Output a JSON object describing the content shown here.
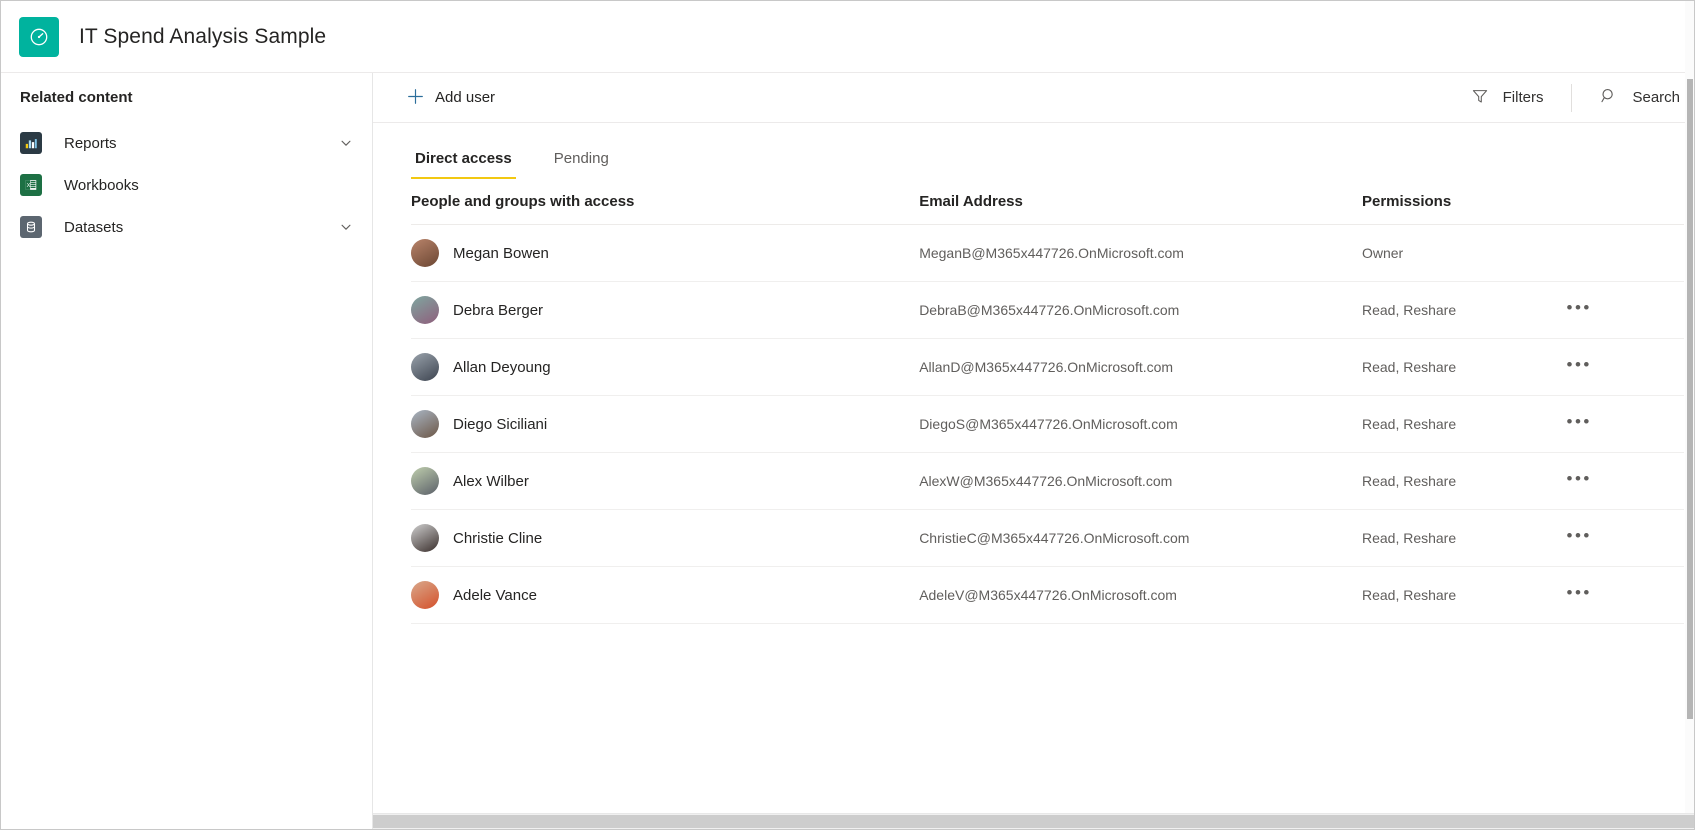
{
  "header": {
    "title": "IT Spend Analysis Sample",
    "logo_icon": "gauge-icon",
    "logo_color": "#00b39e"
  },
  "sidebar": {
    "title": "Related content",
    "items": [
      {
        "label": "Reports",
        "icon": "bar-chart-icon",
        "icon_color": "#2b3a44",
        "expandable": true
      },
      {
        "label": "Workbooks",
        "icon": "excel-sheet-icon",
        "icon_color": "#1d7044",
        "expandable": false
      },
      {
        "label": "Datasets",
        "icon": "database-icon",
        "icon_color": "#5c6670",
        "expandable": true
      }
    ]
  },
  "commandbar": {
    "add_user": {
      "label": "Add user",
      "icon": "plus-icon"
    },
    "filters": {
      "label": "Filters",
      "icon": "filter-icon"
    },
    "search": {
      "label": "Search",
      "icon": "search-icon"
    }
  },
  "tabs": [
    {
      "label": "Direct access",
      "active": true
    },
    {
      "label": "Pending",
      "active": false
    }
  ],
  "table": {
    "columns": [
      "People and groups with access",
      "Email Address",
      "Permissions"
    ],
    "menu_glyph": "•••",
    "rows": [
      {
        "name": "Megan Bowen",
        "email": "MeganB@M365x447726.OnMicrosoft.com",
        "permissions": "Owner",
        "has_menu": false,
        "avatar_a": "#b9846b",
        "avatar_b": "#6b4632"
      },
      {
        "name": "Debra Berger",
        "email": "DebraB@M365x447726.OnMicrosoft.com",
        "permissions": "Read, Reshare",
        "has_menu": true,
        "avatar_a": "#7fa7a0",
        "avatar_b": "#8f5e7c"
      },
      {
        "name": "Allan Deyoung",
        "email": "AllanD@M365x447726.OnMicrosoft.com",
        "permissions": "Read, Reshare",
        "has_menu": true,
        "avatar_a": "#9aa3ac",
        "avatar_b": "#3d4450"
      },
      {
        "name": "Diego Siciliani",
        "email": "DiegoS@M365x447726.OnMicrosoft.com",
        "permissions": "Read, Reshare",
        "has_menu": true,
        "avatar_a": "#a9b6c4",
        "avatar_b": "#6c5646"
      },
      {
        "name": "Alex Wilber",
        "email": "AlexW@M365x447726.OnMicrosoft.com",
        "permissions": "Read, Reshare",
        "has_menu": true,
        "avatar_a": "#c0cfae",
        "avatar_b": "#5a5f68"
      },
      {
        "name": "Christie Cline",
        "email": "ChristieC@M365x447726.OnMicrosoft.com",
        "permissions": "Read, Reshare",
        "has_menu": true,
        "avatar_a": "#cfcfcf",
        "avatar_b": "#3a2f2c"
      },
      {
        "name": "Adele Vance",
        "email": "AdeleV@M365x447726.OnMicrosoft.com",
        "permissions": "Read, Reshare",
        "has_menu": true,
        "avatar_a": "#d9a98c",
        "avatar_b": "#d4502a"
      }
    ]
  }
}
